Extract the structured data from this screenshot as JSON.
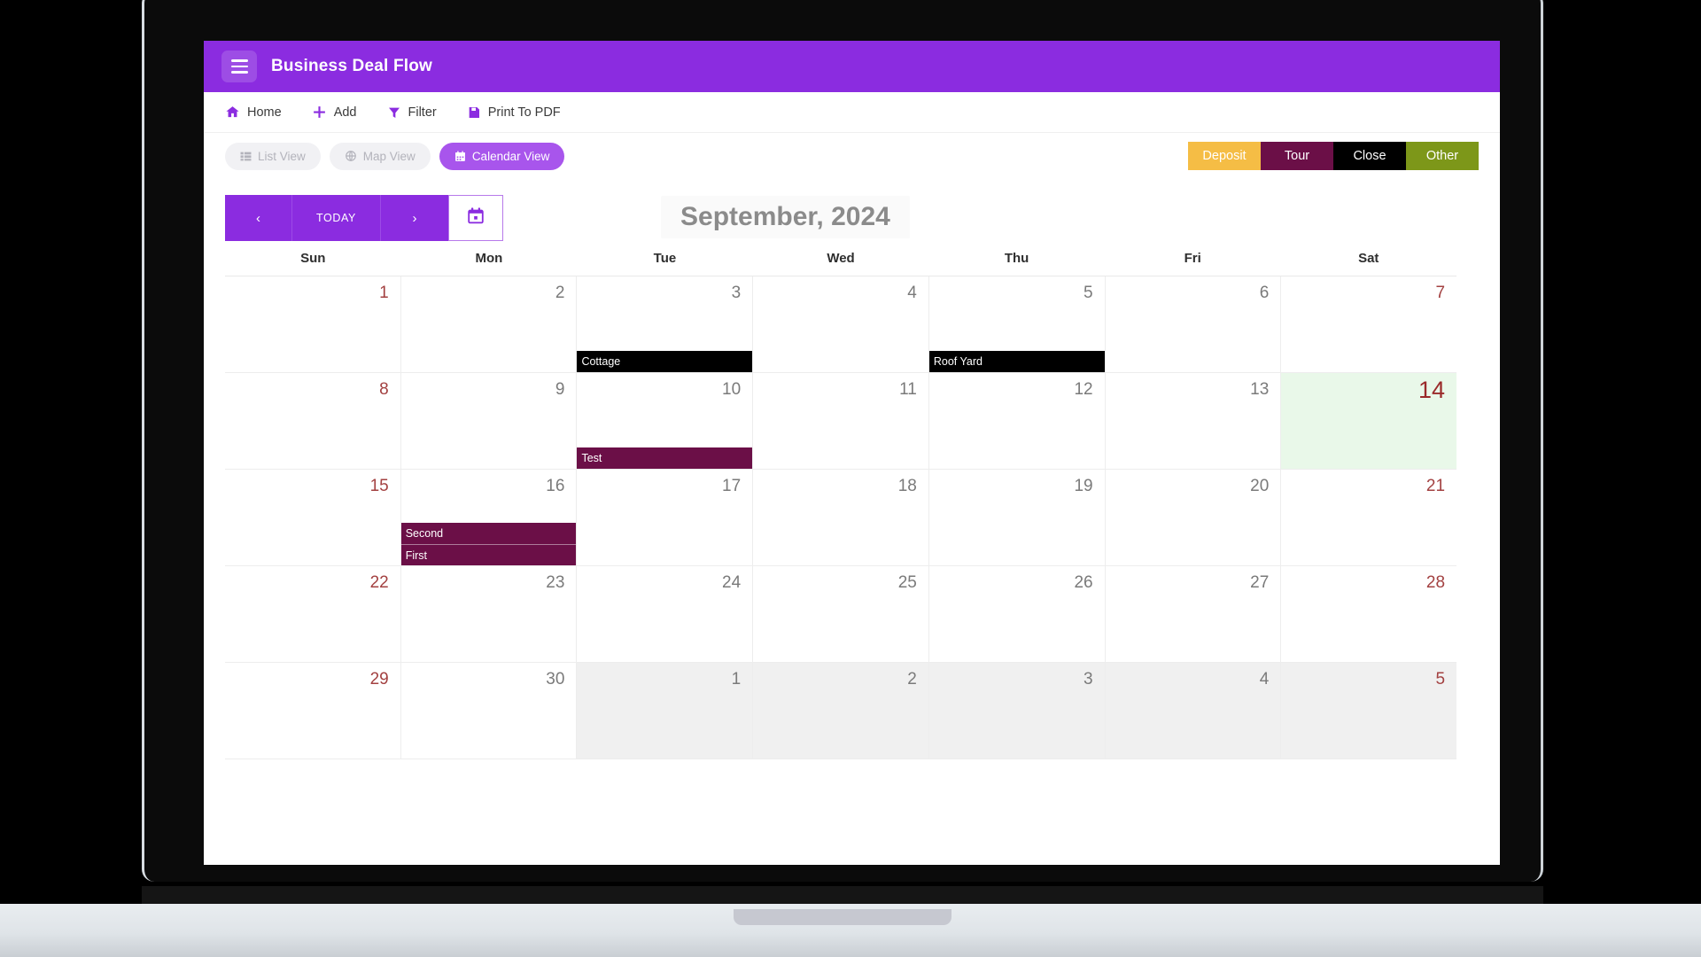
{
  "app": {
    "title": "Business Deal Flow",
    "menu_icon": "hamburger-icon"
  },
  "toolbar": {
    "items": [
      {
        "label": "Home",
        "icon": "home-icon"
      },
      {
        "label": "Add",
        "icon": "plus-icon"
      },
      {
        "label": "Filter",
        "icon": "filter-icon"
      },
      {
        "label": "Print To PDF",
        "icon": "save-pdf-icon"
      }
    ]
  },
  "view_switch": {
    "items": [
      {
        "label": "List View",
        "icon": "list-icon",
        "active": false
      },
      {
        "label": "Map View",
        "icon": "globe-icon",
        "active": false
      },
      {
        "label": "Calendar View",
        "icon": "calendar-icon",
        "active": true
      }
    ]
  },
  "status_legend": {
    "items": [
      {
        "label": "Deposit",
        "color": "#f5bd45"
      },
      {
        "label": "Tour",
        "color": "#6b0f47"
      },
      {
        "label": "Close",
        "color": "#000000"
      },
      {
        "label": "Other",
        "color": "#7d9719"
      }
    ]
  },
  "calendar": {
    "nav": {
      "prev_label": "‹",
      "today_label": "TODAY",
      "next_label": "›",
      "datepicker_icon": "calendar-icon"
    },
    "month_title": "September, 2024",
    "weekdays": [
      "Sun",
      "Mon",
      "Tue",
      "Wed",
      "Thu",
      "Fri",
      "Sat"
    ],
    "weeks": [
      [
        {
          "num": "1",
          "weekend": true,
          "other": false,
          "today": false,
          "events": []
        },
        {
          "num": "2",
          "weekend": false,
          "other": false,
          "today": false,
          "events": []
        },
        {
          "num": "3",
          "weekend": false,
          "other": false,
          "today": false,
          "events": [
            {
              "title": "Cottage",
              "color": "#000000"
            }
          ]
        },
        {
          "num": "4",
          "weekend": false,
          "other": false,
          "today": false,
          "events": []
        },
        {
          "num": "5",
          "weekend": false,
          "other": false,
          "today": false,
          "events": [
            {
              "title": "Roof Yard",
              "color": "#000000"
            }
          ]
        },
        {
          "num": "6",
          "weekend": false,
          "other": false,
          "today": false,
          "events": []
        },
        {
          "num": "7",
          "weekend": true,
          "other": false,
          "today": false,
          "events": []
        }
      ],
      [
        {
          "num": "8",
          "weekend": true,
          "other": false,
          "today": false,
          "events": []
        },
        {
          "num": "9",
          "weekend": false,
          "other": false,
          "today": false,
          "events": []
        },
        {
          "num": "10",
          "weekend": false,
          "other": false,
          "today": false,
          "events": [
            {
              "title": "Test",
              "color": "#6b0f47"
            }
          ]
        },
        {
          "num": "11",
          "weekend": false,
          "other": false,
          "today": false,
          "events": []
        },
        {
          "num": "12",
          "weekend": false,
          "other": false,
          "today": false,
          "events": []
        },
        {
          "num": "13",
          "weekend": false,
          "other": false,
          "today": false,
          "events": []
        },
        {
          "num": "14",
          "weekend": true,
          "other": false,
          "today": true,
          "events": []
        }
      ],
      [
        {
          "num": "15",
          "weekend": true,
          "other": false,
          "today": false,
          "events": []
        },
        {
          "num": "16",
          "weekend": false,
          "other": false,
          "today": false,
          "events": [
            {
              "title": "Second",
              "color": "#6b0f47"
            },
            {
              "title": "First",
              "color": "#6b0f47"
            }
          ]
        },
        {
          "num": "17",
          "weekend": false,
          "other": false,
          "today": false,
          "events": []
        },
        {
          "num": "18",
          "weekend": false,
          "other": false,
          "today": false,
          "events": []
        },
        {
          "num": "19",
          "weekend": false,
          "other": false,
          "today": false,
          "events": []
        },
        {
          "num": "20",
          "weekend": false,
          "other": false,
          "today": false,
          "events": []
        },
        {
          "num": "21",
          "weekend": true,
          "other": false,
          "today": false,
          "events": []
        }
      ],
      [
        {
          "num": "22",
          "weekend": true,
          "other": false,
          "today": false,
          "events": []
        },
        {
          "num": "23",
          "weekend": false,
          "other": false,
          "today": false,
          "events": []
        },
        {
          "num": "24",
          "weekend": false,
          "other": false,
          "today": false,
          "events": []
        },
        {
          "num": "25",
          "weekend": false,
          "other": false,
          "today": false,
          "events": []
        },
        {
          "num": "26",
          "weekend": false,
          "other": false,
          "today": false,
          "events": []
        },
        {
          "num": "27",
          "weekend": false,
          "other": false,
          "today": false,
          "events": []
        },
        {
          "num": "28",
          "weekend": true,
          "other": false,
          "today": false,
          "events": []
        }
      ],
      [
        {
          "num": "29",
          "weekend": true,
          "other": false,
          "today": false,
          "events": []
        },
        {
          "num": "30",
          "weekend": false,
          "other": false,
          "today": false,
          "events": []
        },
        {
          "num": "1",
          "weekend": false,
          "other": true,
          "today": false,
          "events": []
        },
        {
          "num": "2",
          "weekend": false,
          "other": true,
          "today": false,
          "events": []
        },
        {
          "num": "3",
          "weekend": false,
          "other": true,
          "today": false,
          "events": []
        },
        {
          "num": "4",
          "weekend": false,
          "other": true,
          "today": false,
          "events": []
        },
        {
          "num": "5",
          "weekend": true,
          "other": true,
          "today": false,
          "events": []
        }
      ]
    ]
  },
  "colors": {
    "brand_purple": "#8b2ce0",
    "pill_active": "#a855ec",
    "today_bg": "#e9f8e9",
    "weekend_num": "#a34141"
  }
}
